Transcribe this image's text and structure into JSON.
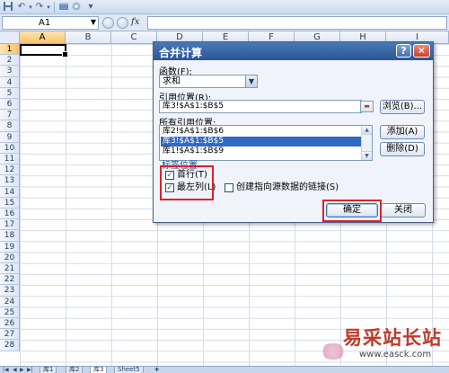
{
  "qat": {
    "icons": [
      "save-icon",
      "undo-icon",
      "redo-icon",
      "open-icon",
      "email-icon",
      "customize-icon"
    ],
    "undo_glyph": "↶",
    "redo_glyph": "↷",
    "customize_glyph": "▾"
  },
  "formula_bar": {
    "name_box": "A1",
    "fx": "fx",
    "formula": ""
  },
  "sheet": {
    "columns": [
      "A",
      "B",
      "C",
      "D",
      "E",
      "F",
      "G",
      "H",
      "I"
    ],
    "rows": [
      "1",
      "2",
      "3",
      "4",
      "5",
      "6",
      "7",
      "8",
      "9",
      "10",
      "11",
      "12",
      "13",
      "14",
      "15",
      "16",
      "17",
      "18",
      "19",
      "20",
      "21",
      "22",
      "23",
      "24",
      "25",
      "26",
      "27",
      "28"
    ],
    "selected_cell": "A1",
    "tabs": [
      "库1",
      "库2",
      "库3",
      "Sheet5"
    ],
    "active_tab": "库3"
  },
  "dialog": {
    "title": "合并计算",
    "help": "?",
    "close": "✕",
    "function_label": "函数(F):",
    "function_value": "求和",
    "reference_label": "引用位置(R):",
    "reference_value": "库3!$A$1:$B$5",
    "browse_button": "浏览(B)...",
    "all_refs_label": "所有引用位置:",
    "all_refs": [
      "库2!$A$1:$B$6",
      "库3!$A$1:$B$5",
      "库1!$A$1:$B$9"
    ],
    "selected_ref_index": 1,
    "add_button": "添加(A)",
    "delete_button": "删除(D)",
    "group_label": "标签位置",
    "top_row_label": "首行(T)",
    "top_row_checked": true,
    "left_column_label": "最左列(L)",
    "left_column_checked": true,
    "link_label": "创建指向源数据的链接(S)",
    "link_checked": false,
    "ok_button": "确定",
    "close_button": "关闭"
  },
  "watermark": {
    "text": "易采站长站",
    "url": "www.easck.com"
  },
  "colors": {
    "title_bar": "#2c5697",
    "highlight_box": "#e0202a",
    "selection": "#316ac5"
  }
}
